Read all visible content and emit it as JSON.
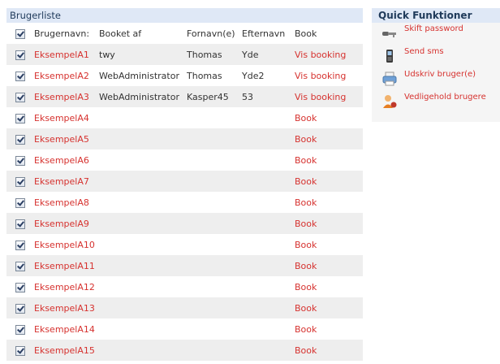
{
  "panel": {
    "title": "Brugerliste"
  },
  "table": {
    "headers": [
      "Brugernavn:",
      "Booket af",
      "Fornavn(e)",
      "Efternavn",
      "Book"
    ],
    "rows": [
      {
        "user": "EksempelA1",
        "booked_by": "twy",
        "first": "Thomas",
        "last": "Yde",
        "action": "Vis booking"
      },
      {
        "user": "EksempelA2",
        "booked_by": "WebAdministrator",
        "first": "Thomas",
        "last": "Yde2",
        "action": "Vis booking"
      },
      {
        "user": "EksempelA3",
        "booked_by": "WebAdministrator",
        "first": "Kasper45",
        "last": "53",
        "action": "Vis booking"
      },
      {
        "user": "EksempelA4",
        "booked_by": "",
        "first": "",
        "last": "",
        "action": "Book"
      },
      {
        "user": "EksempelA5",
        "booked_by": "",
        "first": "",
        "last": "",
        "action": "Book"
      },
      {
        "user": "EksempelA6",
        "booked_by": "",
        "first": "",
        "last": "",
        "action": "Book"
      },
      {
        "user": "EksempelA7",
        "booked_by": "",
        "first": "",
        "last": "",
        "action": "Book"
      },
      {
        "user": "EksempelA8",
        "booked_by": "",
        "first": "",
        "last": "",
        "action": "Book"
      },
      {
        "user": "EksempelA9",
        "booked_by": "",
        "first": "",
        "last": "",
        "action": "Book"
      },
      {
        "user": "EksempelA10",
        "booked_by": "",
        "first": "",
        "last": "",
        "action": "Book"
      },
      {
        "user": "EksempelA11",
        "booked_by": "",
        "first": "",
        "last": "",
        "action": "Book"
      },
      {
        "user": "EksempelA12",
        "booked_by": "",
        "first": "",
        "last": "",
        "action": "Book"
      },
      {
        "user": "EksempelA13",
        "booked_by": "",
        "first": "",
        "last": "",
        "action": "Book"
      },
      {
        "user": "EksempelA14",
        "booked_by": "",
        "first": "",
        "last": "",
        "action": "Book"
      },
      {
        "user": "EksempelA15",
        "booked_by": "",
        "first": "",
        "last": "",
        "action": "Book"
      }
    ]
  },
  "quick": {
    "title": "Quick Funktioner",
    "items": [
      {
        "label": "Skift password",
        "icon": "key-icon"
      },
      {
        "label": "Send sms",
        "icon": "mobile-phone-icon"
      },
      {
        "label": "Udskriv bruger(e)",
        "icon": "printer-icon"
      },
      {
        "label": "Vedligehold brugere",
        "icon": "user-settings-icon"
      }
    ]
  },
  "colors": {
    "link": "#d6322f",
    "header_bg": "#dfe8f6",
    "row_alt": "#eeeeee"
  }
}
